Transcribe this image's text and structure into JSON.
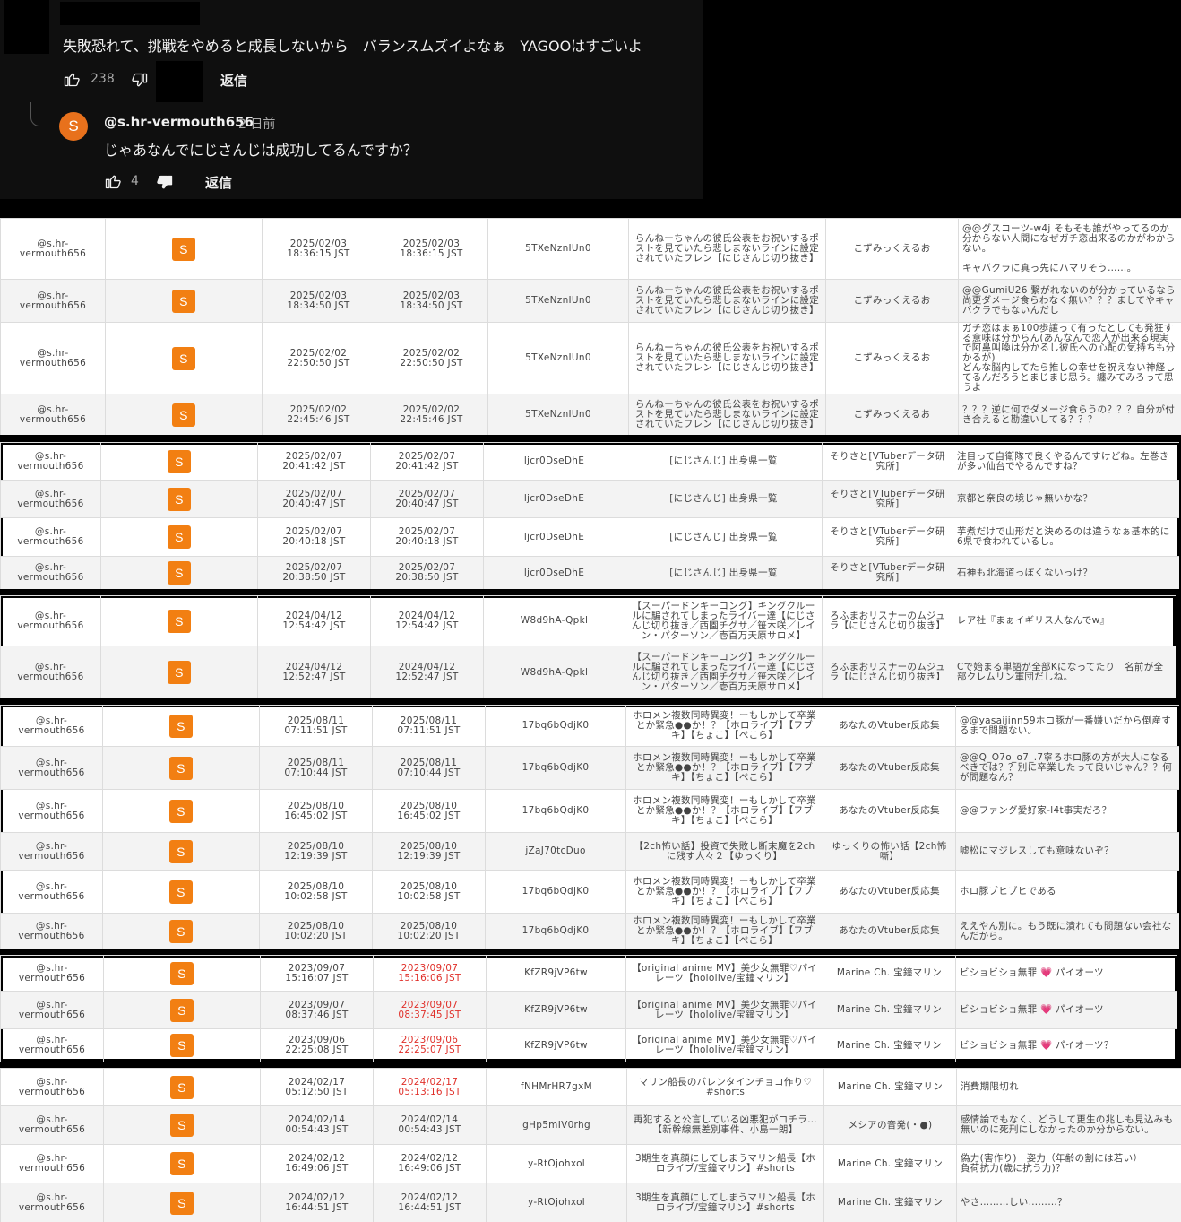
{
  "top": {
    "comment_text": "失敗恐れて、挑戦をやめると成長しないから　バランスムズイよなぁ　YAGOOはすごいよ",
    "comment_likes": "238",
    "reply_label": "返信",
    "reply": {
      "avatar_letter": "S",
      "author": "@s.hr-vermouth656",
      "time": "2 日前",
      "text": "じゃあなんでにじさんじは成功してるんですか？",
      "likes": "4",
      "reply_label": "返信"
    }
  },
  "groups": [
    {
      "rows": [
        {
          "user": "@s.hr-vermouth656",
          "avatar": "S",
          "posted": "2025/02/03\n18:36:15 JST",
          "updated": "2025/02/03\n18:36:15 JST",
          "updated_red": false,
          "video_id": "5TXeNznIUn0",
          "title": "らんねーちゃんの彼氏公表をお祝いするポストを見ていたら悲しまないラインに設定されていたフレン【にじさんじ切り抜き】",
          "channel": "こずみっくえるお",
          "comment": "@@グスコーツ-w4j そもそも誰がやってるのか分からない人間になぜガチ恋出来るのかがわからない。\n\nキャバクラに真っ先にハマリそう……。"
        },
        {
          "user": "@s.hr-vermouth656",
          "avatar": "S",
          "posted": "2025/02/03\n18:34:50 JST",
          "updated": "2025/02/03\n18:34:50 JST",
          "updated_red": false,
          "video_id": "5TXeNznIUn0",
          "title": "らんねーちゃんの彼氏公表をお祝いするポストを見ていたら悲しまないラインに設定されていたフレン【にじさんじ切り抜き】",
          "channel": "こずみっくえるお",
          "comment": "@@GumiU26 繋がれないのが分かっているなら尚更ダメージ食らわなく無い？？？ましてやキャバクラでもないんだし"
        },
        {
          "user": "@s.hr-vermouth656",
          "avatar": "S",
          "posted": "2025/02/02\n22:50:50 JST",
          "updated": "2025/02/02\n22:50:50 JST",
          "updated_red": false,
          "video_id": "5TXeNznIUn0",
          "title": "らんねーちゃんの彼氏公表をお祝いするポストを見ていたら悲しまないラインに設定されていたフレン【にじさんじ切り抜き】",
          "channel": "こずみっくえるお",
          "comment": "ガチ恋はまぁ100歩譲って有ったとしても発狂する意味は分からん(あんなんで恋人が出来る現実で阿鼻叫喚は分かるし彼氏への心配の気持ちも分かるが)\nどんな脳内してたら推しの幸せを祝えない神経してるんだろうとまじまじ思う。纏みてみろって思うよ"
        },
        {
          "user": "@s.hr-vermouth656",
          "avatar": "S",
          "posted": "2025/02/02\n22:45:46 JST",
          "updated": "2025/02/02\n22:45:46 JST",
          "updated_red": false,
          "video_id": "5TXeNznIUn0",
          "title": "らんねーちゃんの彼氏公表をお祝いするポストを見ていたら悲しまないラインに設定されていたフレン【にじさんじ切り抜き】",
          "channel": "こずみっくえるお",
          "comment": "？？？逆に何でダメージ食らうの？？？自分が付き合えると勘違いしてる？？？"
        }
      ]
    },
    {
      "rows": [
        {
          "user": "@s.hr-vermouth656",
          "avatar": "S",
          "posted": "2025/02/07\n20:41:42 JST",
          "updated": "2025/02/07\n20:41:42 JST",
          "updated_red": false,
          "video_id": "ljcr0DseDhE",
          "title": "[にじさんじ] 出身県一覧",
          "channel": "そりさと[VTuberデータ研究所]",
          "comment": "注目って自衛隊で良くやるんですけどね。左巻きが多い仙台でやるんですね？"
        },
        {
          "user": "@s.hr-vermouth656",
          "avatar": "S",
          "posted": "2025/02/07\n20:40:47 JST",
          "updated": "2025/02/07\n20:40:47 JST",
          "updated_red": false,
          "video_id": "ljcr0DseDhE",
          "title": "[にじさんじ] 出身県一覧",
          "channel": "そりさと[VTuberデータ研究所]",
          "comment": "京都と奈良の境じゃ無いかな？"
        },
        {
          "user": "@s.hr-vermouth656",
          "avatar": "S",
          "posted": "2025/02/07\n20:40:18 JST",
          "updated": "2025/02/07\n20:40:18 JST",
          "updated_red": false,
          "video_id": "ljcr0DseDhE",
          "title": "[にじさんじ] 出身県一覧",
          "channel": "そりさと[VTuberデータ研究所]",
          "comment": "芋煮だけで山形だと決めるのは違うなぁ基本的に6県で食われているし。"
        },
        {
          "user": "@s.hr-vermouth656",
          "avatar": "S",
          "posted": "2025/02/07\n20:38:50 JST",
          "updated": "2025/02/07\n20:38:50 JST",
          "updated_red": false,
          "video_id": "ljcr0DseDhE",
          "title": "[にじさんじ] 出身県一覧",
          "channel": "そりさと[VTuberデータ研究所]",
          "comment": "石神も北海道っぽくないっけ？"
        }
      ]
    },
    {
      "rows": [
        {
          "user": "@s.hr-vermouth656",
          "avatar": "S",
          "posted": "2024/04/12\n12:54:42 JST",
          "updated": "2024/04/12\n12:54:42 JST",
          "updated_red": false,
          "video_id": "W8d9hA-Qpkl",
          "title": "【スーパードンキーコング】キングクルールに騙されてしまったライバー達【にじさんじ切り抜き／西園チグサ／笹木咲／レイン・パターソン／壱百万天原サロメ】",
          "channel": "ろふまおリスナーのムジュラ【にじさんじ切り抜き】",
          "comment": "レア社『まぁイギリス人なんでw』"
        },
        {
          "user": "@s.hr-vermouth656",
          "avatar": "S",
          "posted": "2024/04/12\n12:52:47 JST",
          "updated": "2024/04/12\n12:52:47 JST",
          "updated_red": false,
          "video_id": "W8d9hA-Qpkl",
          "title": "【スーパードンキーコング】キングクルールに騙されてしまったライバー達【にじさんじ切り抜き／西園チグサ／笹木咲／レイン・パターソン／壱百万天原サロメ】",
          "channel": "ろふまおリスナーのムジュラ【にじさんじ切り抜き】",
          "comment": "Cで始まる単語が全部Kになってたり　名前が全部クレムリン軍団だしね。"
        }
      ]
    },
    {
      "rows": [
        {
          "user": "@s.hr-vermouth656",
          "avatar": "S",
          "posted": "2025/08/11\n07:11:51 JST",
          "updated": "2025/08/11\n07:11:51 JST",
          "updated_red": false,
          "video_id": "17bq6bQdjK0",
          "title": "ホロメン複数同時異変！ーもしかして卒業とか緊急●●か！？【ホロライブ】【フブキ】【ちょこ】【ぺこら】",
          "channel": "あなたのVtuber反応集",
          "comment": "@@yasaijinn59ホロ豚が一番嫌いだから倒産するまで問題ない。"
        },
        {
          "user": "@s.hr-vermouth656",
          "avatar": "S",
          "posted": "2025/08/11\n07:10:44 JST",
          "updated": "2025/08/11\n07:10:44 JST",
          "updated_red": false,
          "video_id": "17bq6bQdjK0",
          "title": "ホロメン複数同時異変！ーもしかして卒業とか緊急●●か！？【ホロライブ】【フブキ】【ちょこ】【ぺこら】",
          "channel": "あなたのVtuber反応集",
          "comment": "@@Q_O7o_o7_.7寧ろホロ豚の方が大人になるべきでは？？別に卒業したって良いじゃん？？何が問題なん？"
        },
        {
          "user": "@s.hr-vermouth656",
          "avatar": "S",
          "posted": "2025/08/10\n16:45:02 JST",
          "updated": "2025/08/10\n16:45:02 JST",
          "updated_red": false,
          "video_id": "17bq6bQdjK0",
          "title": "ホロメン複数同時異変！ーもしかして卒業とか緊急●●か！？【ホロライブ】【フブキ】【ちょこ】【ぺこら】",
          "channel": "あなたのVtuber反応集",
          "comment": "@@ファング愛好家-l4t事実だろ？"
        },
        {
          "user": "@s.hr-vermouth656",
          "avatar": "S",
          "posted": "2025/08/10\n12:19:39 JST",
          "updated": "2025/08/10\n12:19:39 JST",
          "updated_red": false,
          "video_id": "jZaJ70tcDuo",
          "title": "【2ch怖い話】投資で失敗し断末魔を2chに残す人々２【ゆっくり】",
          "channel": "ゆっくりの怖い話【2ch怖噺】",
          "comment": "嘘松にマジレスしても意味ないぞ？"
        },
        {
          "user": "@s.hr-vermouth656",
          "avatar": "S",
          "posted": "2025/08/10\n10:02:58 JST",
          "updated": "2025/08/10\n10:02:58 JST",
          "updated_red": false,
          "video_id": "17bq6bQdjK0",
          "title": "ホロメン複数同時異変！ーもしかして卒業とか緊急●●か！？【ホロライブ】【フブキ】【ちょこ】【ぺこら】",
          "channel": "あなたのVtuber反応集",
          "comment": "ホロ豚ブヒブヒである"
        },
        {
          "user": "@s.hr-vermouth656",
          "avatar": "S",
          "posted": "2025/08/10\n10:02:20 JST",
          "updated": "2025/08/10\n10:02:20 JST",
          "updated_red": false,
          "video_id": "17bq6bQdjK0",
          "title": "ホロメン複数同時異変！ーもしかして卒業とか緊急●●か！？【ホロライブ】【フブキ】【ちょこ】【ぺこら】",
          "channel": "あなたのVtuber反応集",
          "comment": "ええやん別に。もう既に潰れても問題ない会社なんだから。"
        }
      ]
    },
    {
      "rows": [
        {
          "user": "@s.hr-vermouth656",
          "avatar": "S",
          "posted": "2023/09/07\n15:16:07 JST",
          "updated": "2023/09/07\n15:16:06 JST",
          "updated_red": true,
          "video_id": "KfZR9jVP6tw",
          "title": "【original anime MV】美少女無罪♡パイレーツ【hololive/宝鐘マリン】",
          "channel": "Marine Ch. 宝鐘マリン",
          "comment": "ビショビショ無罪 💗 パイオーツ"
        },
        {
          "user": "@s.hr-vermouth656",
          "avatar": "S",
          "posted": "2023/09/07\n08:37:46 JST",
          "updated": "2023/09/07\n08:37:45 JST",
          "updated_red": true,
          "video_id": "KfZR9jVP6tw",
          "title": "【original anime MV】美少女無罪♡パイレーツ【hololive/宝鐘マリン】",
          "channel": "Marine Ch. 宝鐘マリン",
          "comment": "ビショビショ無罪 💗 パイオーツ"
        },
        {
          "user": "@s.hr-vermouth656",
          "avatar": "S",
          "posted": "2023/09/06\n22:25:08 JST",
          "updated": "2023/09/06\n22:25:07 JST",
          "updated_red": true,
          "video_id": "KfZR9jVP6tw",
          "title": "【original anime MV】美少女無罪♡パイレーツ【hololive/宝鐘マリン】",
          "channel": "Marine Ch. 宝鐘マリン",
          "comment": "ビショビショ無罪 💗 パイオーツ？"
        }
      ]
    },
    {
      "rows": [
        {
          "user": "@s.hr-vermouth656",
          "avatar": "S",
          "posted": "2024/02/17\n05:12:50 JST",
          "updated": "2024/02/17\n05:13:16 JST",
          "updated_red": true,
          "video_id": "fNHMrHR7gxM",
          "title": "マリン船長のバレンタインチョコ作り♡ #shorts",
          "channel": "Marine Ch. 宝鐘マリン",
          "comment": "消費期限切れ"
        },
        {
          "user": "@s.hr-vermouth656",
          "avatar": "S",
          "posted": "2024/02/14\n00:54:43 JST",
          "updated": "2024/02/14\n00:54:43 JST",
          "updated_red": false,
          "video_id": "gHp5mIV0rhg",
          "title": "再犯すると公言している凶悪犯がコチラ…【新幹線無差別事件、小島一朗】",
          "channel": "メシアの音発(・●)",
          "comment": "感情論でもなく、どうして更生の兆しも見込みも無いのに死刑にしなかったのか分からない。"
        },
        {
          "user": "@s.hr-vermouth656",
          "avatar": "S",
          "posted": "2024/02/12\n16:49:06 JST",
          "updated": "2024/02/12\n16:49:06 JST",
          "updated_red": false,
          "video_id": "y-RtOjohxol",
          "title": "3期生を真顔にしてしまうマリン船長【ホロライブ/宝鐘マリン】#shorts",
          "channel": "Marine Ch. 宝鐘マリン",
          "comment": "偽力(害作り)　姿力（年齢の割には若い）\n負荷抗力(歳に抗う力)？"
        },
        {
          "user": "@s.hr-vermouth656",
          "avatar": "S",
          "posted": "2024/02/12\n16:44:51 JST",
          "updated": "2024/02/12\n16:44:51 JST",
          "updated_red": false,
          "video_id": "y-RtOjohxol",
          "title": "3期生を真顔にしてしまうマリン船長【ホロライブ/宝鐘マリン】#shorts",
          "channel": "Marine Ch. 宝鐘マリン",
          "comment": "やさ………しい………？"
        }
      ]
    }
  ]
}
